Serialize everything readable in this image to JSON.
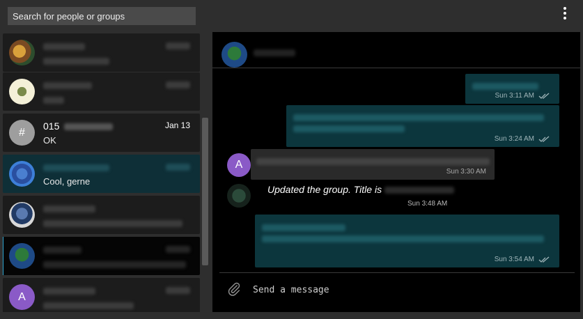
{
  "search": {
    "placeholder": "Search for people or groups"
  },
  "menu": {
    "icon": "more-vertical-icon"
  },
  "contacts": [
    {
      "avatar": "photo",
      "name": "",
      "preview": "",
      "time": ""
    },
    {
      "avatar": "photo",
      "name": "",
      "preview": "",
      "time": ""
    },
    {
      "avatar": "letter",
      "initial": "#",
      "color": "#9e9e9e",
      "name": "015",
      "preview": "OK",
      "time": "Jan 13"
    },
    {
      "avatar": "photo",
      "name": "",
      "preview": "Cool, gerne",
      "time": ""
    },
    {
      "avatar": "photo",
      "name": "",
      "preview": "",
      "time": ""
    },
    {
      "avatar": "photo",
      "name": "",
      "preview": "",
      "time": ""
    },
    {
      "avatar": "letter",
      "initial": "A",
      "color": "#8a5ac7",
      "name": "",
      "preview": "",
      "time": ""
    }
  ],
  "chat": {
    "title": "",
    "messages": [
      {
        "direction": "out",
        "time": "Sun 3:11 AM",
        "status": "read"
      },
      {
        "direction": "out",
        "time": "Sun 3:24 AM",
        "status": "read"
      },
      {
        "direction": "in",
        "sender_initial": "A",
        "sender_color": "#8a5ac7",
        "time": "Sun 3:30 AM"
      },
      {
        "direction": "system",
        "text": "Updated the group. Title is",
        "time": "Sun 3:48 AM"
      },
      {
        "direction": "out",
        "time": "Sun 3:54 AM",
        "status": "read"
      }
    ],
    "composer": {
      "placeholder": "Send a message",
      "attach_icon": "paperclip-icon"
    }
  },
  "colors": {
    "accent": "#2ea5cf",
    "outgoing_bubble": "#0c363d",
    "active_contact": "#0e2f37",
    "avatar_purple": "#8a5ac7"
  }
}
